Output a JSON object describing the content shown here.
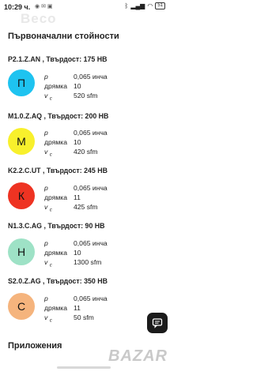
{
  "status_bar": {
    "time": "10:29 ч.",
    "icons_left": [
      "whatsapp-icon",
      "mail-icon",
      "message-icon"
    ],
    "icons_right": [
      "bluetooth-icon",
      "signal-icon",
      "wifi-icon"
    ],
    "battery": "51"
  },
  "watermark": "Beco",
  "page_title": "Първоначални стойности",
  "sections": [
    {
      "header": "P2.1.Z.AN ,  Твърдост: 175 HB",
      "letter": "П",
      "color": "#1ec3f0",
      "p": "0,065",
      "p_unit": "инча",
      "holder_label": "дрямка",
      "holder": "10",
      "vc": "520",
      "vc_unit": "sfm"
    },
    {
      "header": "M1.0.Z.AQ ,  Твърдост: 200 HB",
      "letter": "М",
      "color": "#f8f02c",
      "p": "0,065",
      "p_unit": "инча",
      "holder_label": "дрямка",
      "holder": "10",
      "vc": "420",
      "vc_unit": "sfm"
    },
    {
      "header": "K2.2.C.UT ,  Твърдост: 245 HB",
      "letter": "К",
      "color": "#ee3322",
      "p": "0,065",
      "p_unit": "инча",
      "holder_label": "дрямка",
      "holder": "11",
      "vc": "425",
      "vc_unit": "sfm"
    },
    {
      "header": "N1.3.C.AG ,  Твърдост: 90 HB",
      "letter": "Н",
      "color": "#9ee2c6",
      "p": "0,065",
      "p_unit": "инча",
      "holder_label": "дрямка",
      "holder": "10",
      "vc": "1300",
      "vc_unit": "sfm"
    },
    {
      "header": "S2.0.Z.AG ,  Твърдост: 350 HB",
      "letter": "С",
      "color": "#f5b47d",
      "p": "0,065",
      "p_unit": "инча",
      "holder_label": "дрямка",
      "holder": "11",
      "vc": "50",
      "vc_unit": "sfm"
    }
  ],
  "labels": {
    "p": "p",
    "v": "v",
    "c": "c"
  },
  "apps_title": "Приложения",
  "chat_icon": "chat-icon",
  "bazar_logo": "BAZAR"
}
